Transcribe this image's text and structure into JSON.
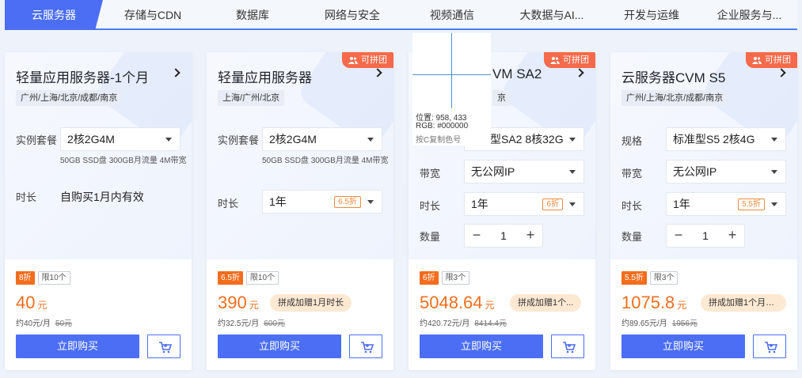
{
  "tabs": [
    "云服务器",
    "存储与CDN",
    "数据库",
    "网络与安全",
    "视频通信",
    "大数据与AI...",
    "开发与运维",
    "企业服务与..."
  ],
  "pin_badge": "可拼团",
  "labels": {
    "instance": "实例套餐",
    "duration": "时长",
    "bandwidth": "带宽",
    "quantity": "数量",
    "spec": "规格",
    "buy": "立即购买"
  },
  "cards": [
    {
      "title": "轻量应用服务器-1个月",
      "regions": "广州/上海/北京/成都/南京",
      "instance": "2核2G4M",
      "instance_note": "50GB SSD盘 300GB月流量 4M带宽",
      "duration_text": "自购买1月内有效",
      "off_tag": "8折",
      "limit_tag": "限10个",
      "price": "40",
      "unit": "元",
      "per_month": "约40元/月",
      "orig": "50元"
    },
    {
      "title": "轻量应用服务器",
      "regions": "上海/广州/北京",
      "instance": "2核2G4M",
      "instance_note": "50GB SSD盘 300GB月流量 4M带宽",
      "duration": "1年",
      "duration_disc": "6.5折",
      "off_tag": "6.5折",
      "limit_tag": "限10个",
      "price": "390",
      "unit": "元",
      "group_tip": "拼成加赠1月时长",
      "per_month": "约32.5元/月",
      "orig": "600元"
    },
    {
      "title": "VM SA2",
      "regions": "京",
      "instance": "型SA2 8核32G",
      "bandwidth": "无公网IP",
      "duration": "1年",
      "duration_disc": "6折",
      "quantity": "1",
      "off_tag": "6折",
      "limit_tag": "限3个",
      "price": "5048.64",
      "unit": "元",
      "group_tip": "拼成加赠1个...",
      "per_month": "约420.72元/月",
      "orig": "8414.4元"
    },
    {
      "title": "云服务器CVM S5",
      "regions": "广州/上海/北京/成都/南京",
      "spec": "标准型S5 2核4G",
      "bandwidth": "无公网IP",
      "duration": "1年",
      "duration_disc": "5.5折",
      "quantity": "1",
      "off_tag": "5.5折",
      "limit_tag": "限3个",
      "price": "1075.8",
      "unit": "元",
      "group_tip": "拼成加赠1个月时...",
      "per_month": "约89.65元/月",
      "orig": "1956元"
    }
  ],
  "picker": {
    "position": "位置: 958, 433",
    "rgb": "RGB: #000000",
    "hint": "按C复制色号"
  },
  "colors": {
    "accent": "#4b6ef5",
    "price": "#f36d1d",
    "pin_badge": "#f56a4a"
  }
}
